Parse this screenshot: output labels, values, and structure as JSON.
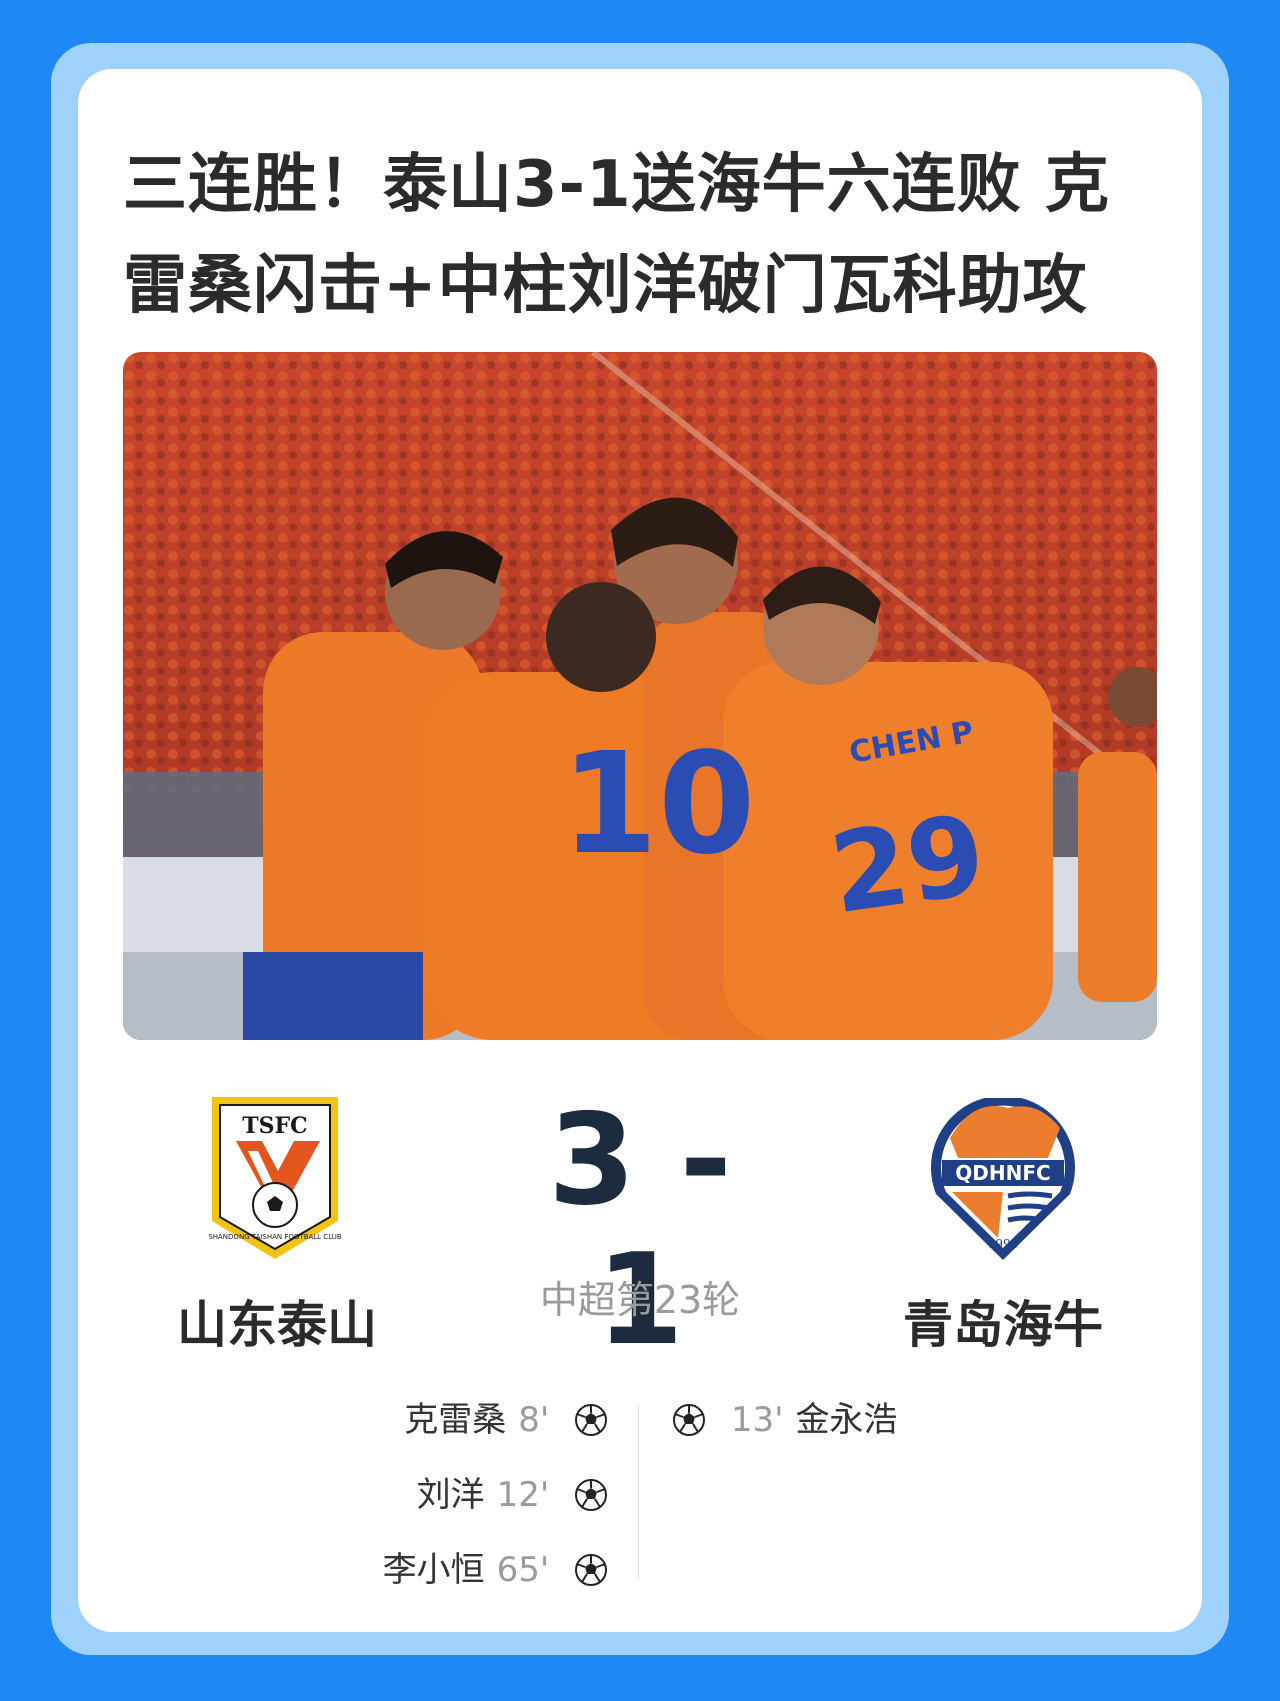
{
  "headline": "三连胜！泰山3-1送海牛六连败 克雷桑闪击+中柱刘洋破门瓦科助攻",
  "match": {
    "home_team": "山东泰山",
    "away_team": "青岛海牛",
    "home_score": "3",
    "separator": "-",
    "away_score": "1",
    "round": "中超第23轮",
    "home_logo_text": "TSFC",
    "home_logo_ring": "SHANDONG TAISHAN FOOTBALL CLUB",
    "away_logo_text": "QDHNFC",
    "away_logo_year": "1993"
  },
  "photo": {
    "jersey_numbers": [
      "10",
      "29"
    ],
    "jersey_name": "CHEN P"
  },
  "home_scorers": [
    {
      "name": "克雷桑",
      "minute": "8'"
    },
    {
      "name": "刘洋",
      "minute": "12'"
    },
    {
      "name": "李小恒",
      "minute": "65'"
    }
  ],
  "away_scorers": [
    {
      "name": "金永浩",
      "minute": "13'"
    }
  ],
  "colors": {
    "page_background": "#1e88f5",
    "frame": "#9fd2fb",
    "card": "#ffffff",
    "score_text": "#1d2b3f",
    "taishan_orange": "#f07a24",
    "taishan_blue": "#2b4db3"
  },
  "icons": {
    "goal": "soccer-ball-icon"
  }
}
